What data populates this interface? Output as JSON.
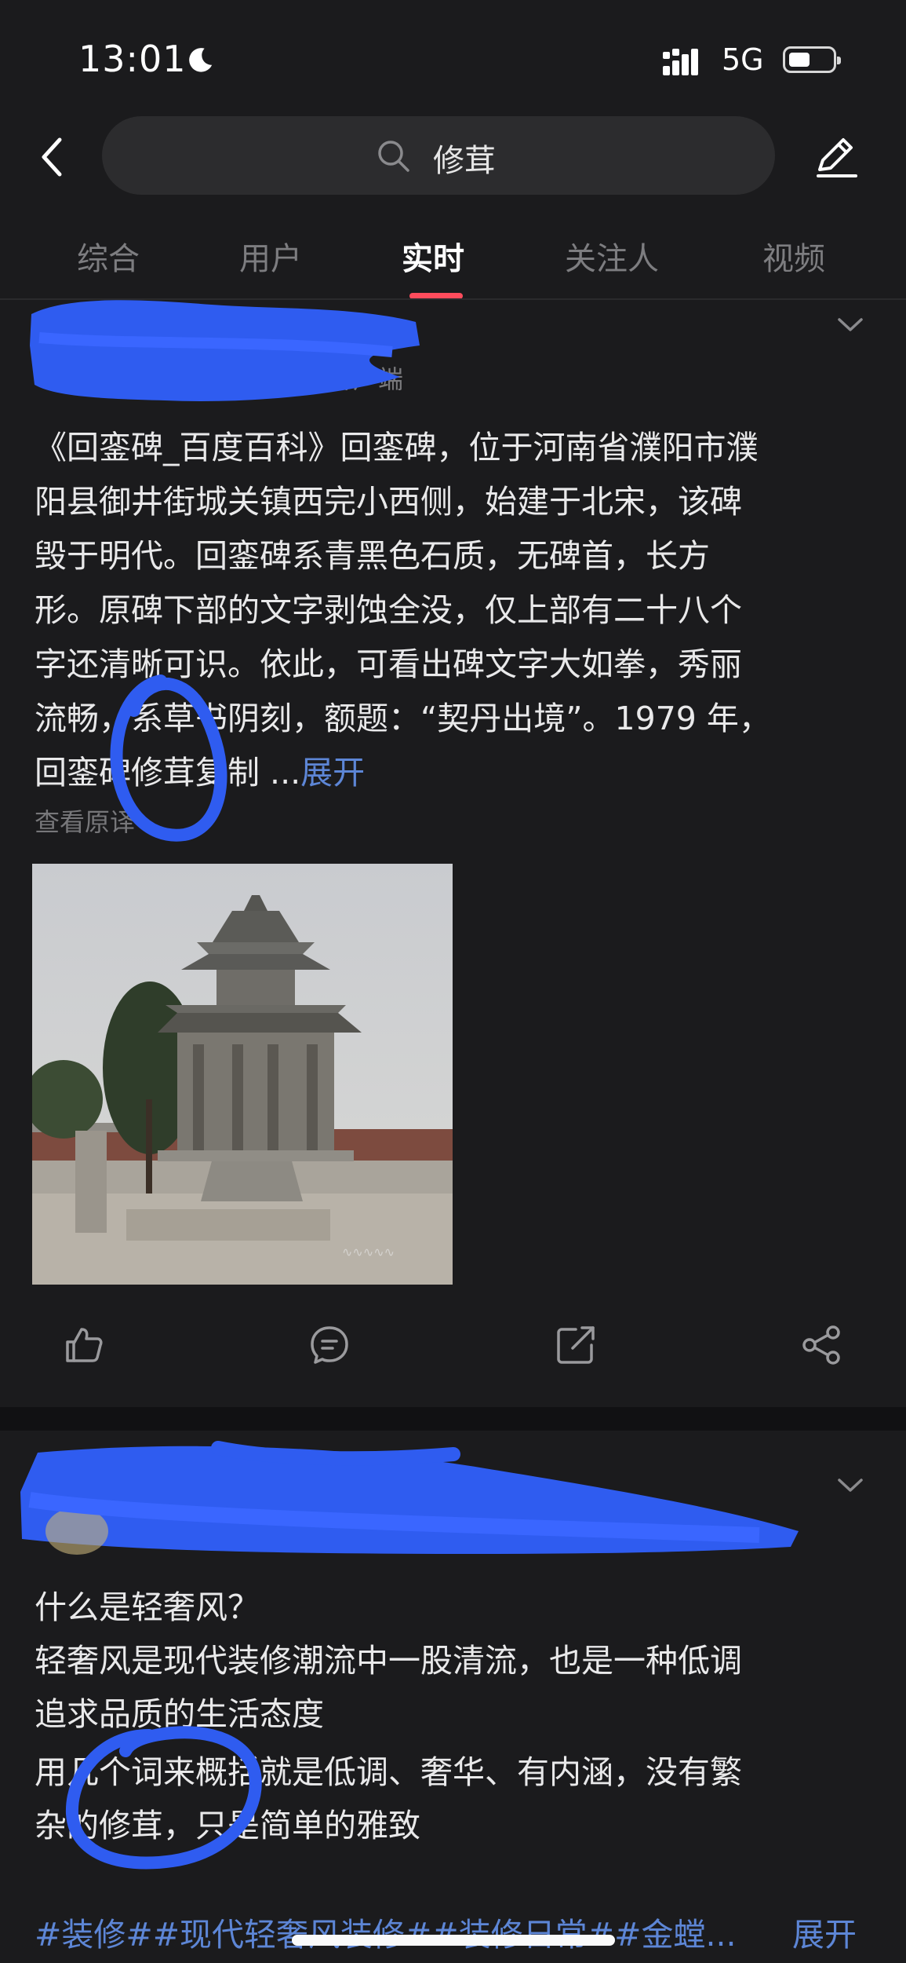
{
  "status_bar": {
    "time": "13:01",
    "network": "5G",
    "battery_level": 0.35
  },
  "search": {
    "query": "修茸"
  },
  "tabs": [
    {
      "label": "综合",
      "active": false
    },
    {
      "label": "用户",
      "active": false
    },
    {
      "label": "实时",
      "active": true
    },
    {
      "label": "关注人",
      "active": false
    },
    {
      "label": "视频",
      "active": false
    }
  ],
  "post1": {
    "meta_fragment": "客户端",
    "body_lines": [
      "《回銮碑_百度百科》回銮碑，位于河南省濮阳市濮",
      "阳县御井街城关镇西完小西侧，始建于北宋，该碑",
      "毁于明代。回銮碑系青黑色石质，无碑首，长方",
      "形。原碑下部的文字剥蚀全没，仅上部有二十八个",
      "字还清晰可识。依此，可看出碑文字大如拳，秀丽",
      "流畅，系草书阴刻，额题：“契丹出境”。1979 年，"
    ],
    "last_line": "回銮碑修茸复制 ...",
    "expand_label": "展开",
    "view_translation": "查看原译",
    "photo_alt": "回銮碑"
  },
  "post2": {
    "lines": [
      "什么是轻奢风？",
      "轻奢风是现代装修潮流中一股清流，也是一种低调",
      "追求品质的生活态度",
      "用几个词来概括就是低调、奢华、有内涵，没有繁",
      "杂的修茸，只是简单的雅致"
    ],
    "tags": "#装修##现代轻奢风装修##装修日常##金螳...",
    "expand_label": "展开"
  },
  "colors": {
    "background": "#1b1b1d",
    "accent_tab": "#ff4c5c",
    "link": "#5d86d6",
    "redaction": "#2f5cf0"
  }
}
